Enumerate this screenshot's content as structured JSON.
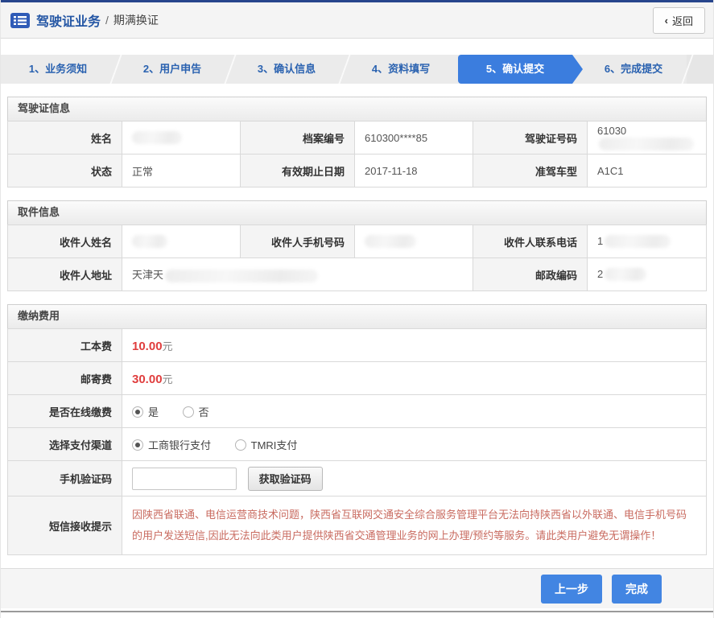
{
  "header": {
    "title": "驾驶证业务",
    "separator": "/",
    "subtitle": "期满换证",
    "back_chevron": "‹",
    "back_label": "返回"
  },
  "steps": [
    {
      "label": "1、业务须知",
      "active": false
    },
    {
      "label": "2、用户申告",
      "active": false
    },
    {
      "label": "3、确认信息",
      "active": false
    },
    {
      "label": "4、资料填写",
      "active": false
    },
    {
      "label": "5、确认提交",
      "active": true
    },
    {
      "label": "6、完成提交",
      "active": false
    }
  ],
  "license": {
    "title": "驾驶证信息",
    "name_label": "姓名",
    "name_value": "",
    "file_label": "档案编号",
    "file_value": "610300****85",
    "licno_label": "驾驶证号码",
    "licno_value": "61030",
    "status_label": "状态",
    "status_value": "正常",
    "expiry_label": "有效期止日期",
    "expiry_value": "2017-11-18",
    "vehicle_label": "准驾车型",
    "vehicle_value": "A1C1"
  },
  "pickup": {
    "title": "取件信息",
    "recipient_label": "收件人姓名",
    "recipient_value": "",
    "mobile_label": "收件人手机号码",
    "mobile_value": "",
    "phone_label": "收件人联系电话",
    "phone_value": "1",
    "address_label": "收件人地址",
    "address_value": "天津天",
    "postcode_label": "邮政编码",
    "postcode_value": "2"
  },
  "fees": {
    "title": "缴纳费用",
    "cost_label": "工本费",
    "cost_value": "10.00",
    "cost_unit": "元",
    "postage_label": "邮寄费",
    "postage_value": "30.00",
    "postage_unit": "元",
    "online_label": "是否在线缴费",
    "online_yes": "是",
    "online_no": "否",
    "channel_label": "选择支付渠道",
    "channel_icbc": "工商银行支付",
    "channel_tmri": "TMRI支付",
    "captcha_label": "手机验证码",
    "captcha_value": "",
    "captcha_button": "获取验证码",
    "notice_label": "短信接收提示",
    "notice_text": "因陕西省联通、电信运营商技术问题，陕西省互联网交通安全综合服务管理平台无法向持陕西省以外联通、电信手机号码的用户发送短信,因此无法向此类用户提供陕西省交通管理业务的网上办理/预约等服务。请此类用户避免无谓操作！"
  },
  "footer": {
    "prev_label": "上一步",
    "finish_label": "完成"
  },
  "colors": {
    "top_strip": "#27458c",
    "active_step_blue": "#3b7dde",
    "step_text_blue": "#2a62b0",
    "fee_red": "#e03e3e",
    "notice_red": "#c96b60",
    "button_blue": "#4285e2"
  }
}
